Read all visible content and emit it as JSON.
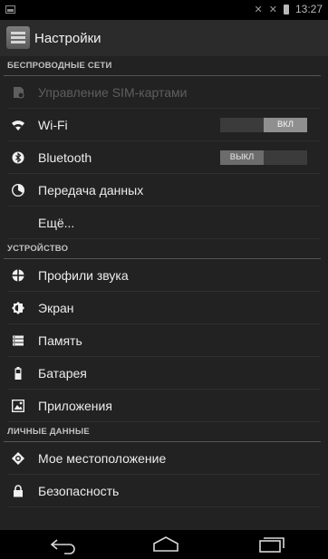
{
  "status_bar": {
    "time": "13:27",
    "icons": [
      "image-notification-icon",
      "signal-x-icon",
      "signal-x-icon",
      "battery-icon"
    ]
  },
  "action_bar": {
    "title": "Настройки",
    "icon": "settings-app-icon"
  },
  "sections": {
    "wireless": {
      "header": "БЕСПРОВОДНЫЕ СЕТИ"
    },
    "device": {
      "header": "УСТРОЙСТВО"
    },
    "personal": {
      "header": "ЛИЧНЫЕ ДАННЫЕ"
    }
  },
  "items": {
    "sim": {
      "label": "Управление SIM-картами",
      "icon": "sim-icon",
      "enabled": false
    },
    "wifi": {
      "label": "Wi-Fi",
      "icon": "wifi-icon",
      "toggle": "ВКЛ",
      "toggle_state": "on"
    },
    "bluetooth": {
      "label": "Bluetooth",
      "icon": "bluetooth-icon",
      "toggle": "ВЫКЛ",
      "toggle_state": "off"
    },
    "data": {
      "label": "Передача данных",
      "icon": "data-usage-icon"
    },
    "more": {
      "label": "Ещё..."
    },
    "sound": {
      "label": "Профили звука",
      "icon": "sound-profile-icon"
    },
    "display": {
      "label": "Экран",
      "icon": "display-icon"
    },
    "storage": {
      "label": "Память",
      "icon": "storage-icon"
    },
    "battery": {
      "label": "Батарея",
      "icon": "battery-icon"
    },
    "apps": {
      "label": "Приложения",
      "icon": "apps-icon"
    },
    "location": {
      "label": "Мое местоположение",
      "icon": "location-icon"
    },
    "security": {
      "label": "Безопасность",
      "icon": "lock-icon"
    }
  },
  "nav_bar": {
    "buttons": [
      "back-icon",
      "home-icon",
      "recents-icon"
    ]
  },
  "colors": {
    "background": "#222222",
    "divider": "#555555",
    "disabled_text": "#5e5e5e"
  }
}
